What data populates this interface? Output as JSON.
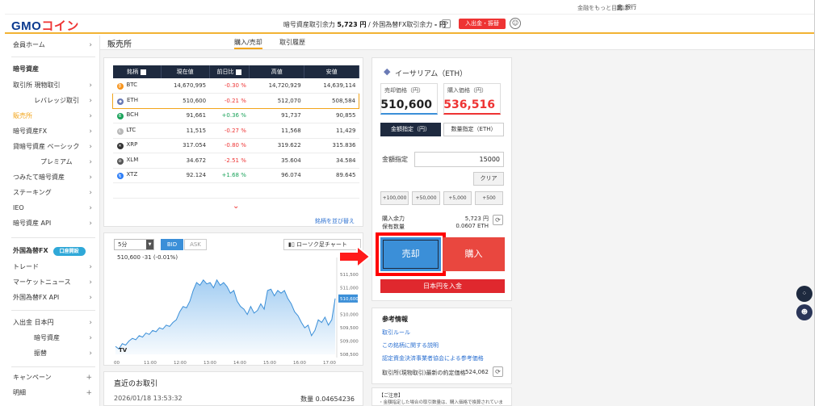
{
  "util_bar": {
    "text": "金融をもっと目的に",
    "bank": "銀行",
    "bank_icon": "bank-icon"
  },
  "header": {
    "logo_main": "GMO",
    "logo_sub": "コイン",
    "margin_label": "暗号資産取引余力",
    "margin_value": "5,723 円",
    "fx_label": "外国為替FX取引余力",
    "fx_value": "- 円",
    "deposit_label": "入出金・振替"
  },
  "sidebar": {
    "home": "会員ホーム",
    "crypto_head": "暗号資産",
    "spot": "取引所 現物取引",
    "leverage": "レバレッジ取引",
    "hanbaisho": "販売所",
    "crypto_fx": "暗号資産FX",
    "basket": "貸暗号資産 ベーシック",
    "premium": "プレミアム",
    "tsumitate": "つみたて暗号資産",
    "staking": "ステーキング",
    "ieo": "IEO",
    "api": "暗号資産 API",
    "fx_head": "外国為替FX",
    "fx_badge": "口座開設",
    "trade": "トレード",
    "market_news": "マーケットニュース",
    "fx_api": "外国為替FX API",
    "deposit_jpy": "入出金 日本円",
    "deposit_crypto": "暗号資産",
    "transfer": "振替",
    "campaign": "キャンペーン",
    "statement": "明細"
  },
  "page": {
    "title": "販売所",
    "tab_buy_sell": "購入/売却",
    "tab_history": "取引履歴"
  },
  "coin_table": {
    "headers": [
      "銘柄",
      "現在値",
      "前日比",
      "高値",
      "安値"
    ],
    "rows": [
      {
        "symbol": "BTC",
        "price": "14,670,995",
        "change": "-0.30 %",
        "high": "14,720,929",
        "low": "14,639,114",
        "dir": "neg",
        "color": "#f7931a",
        "glyph": "₿"
      },
      {
        "symbol": "ETH",
        "price": "510,600",
        "change": "-0.21 %",
        "high": "512,070",
        "low": "508,584",
        "dir": "neg",
        "color": "#6a7ab5",
        "glyph": "◆"
      },
      {
        "symbol": "BCH",
        "price": "91,661",
        "change": "+0.36 %",
        "high": "91,737",
        "low": "90,855",
        "dir": "pos",
        "color": "#1aa35a",
        "glyph": "B"
      },
      {
        "symbol": "LTC",
        "price": "11,515",
        "change": "-0.27 %",
        "high": "11,568",
        "low": "11,429",
        "dir": "neg",
        "color": "#b8b8b8",
        "glyph": "Ł"
      },
      {
        "symbol": "XRP",
        "price": "317.054",
        "change": "-0.80 %",
        "high": "319.622",
        "low": "315.836",
        "dir": "neg",
        "color": "#333333",
        "glyph": "✕"
      },
      {
        "symbol": "XLM",
        "price": "34.672",
        "change": "-2.51 %",
        "high": "35.604",
        "low": "34.584",
        "dir": "neg",
        "color": "#555555",
        "glyph": "⊘"
      },
      {
        "symbol": "XTZ",
        "price": "92.124",
        "change": "+1.68 %",
        "high": "96.074",
        "low": "89.645",
        "dir": "pos",
        "color": "#2c7df7",
        "glyph": "ꜩ"
      }
    ],
    "reorder": "銘柄を並び替え"
  },
  "chart_panel": {
    "interval": "5分",
    "bid": "BID",
    "ask": "ASK",
    "candle": "ローソク足チャート",
    "label": "510,600 -31 (-0.01%)",
    "logo": "TV"
  },
  "chart_data": {
    "type": "area",
    "x_ticks": [
      "00",
      "11:00",
      "12:00",
      "13:00",
      "14:00",
      "15:00",
      "16:00",
      "17:00"
    ],
    "y_ticks": [
      "511,500",
      "511,000",
      "510,600",
      "510,000",
      "509,500",
      "509,000",
      "508,500"
    ],
    "ylim": [
      508500,
      511900
    ],
    "current": 510600,
    "values": [
      508800,
      508700,
      508900,
      508850,
      509000,
      509100,
      509050,
      509200,
      509150,
      509300,
      509250,
      509400,
      509350,
      509500,
      509450,
      509600,
      509550,
      509700,
      509800,
      510100,
      510300,
      510250,
      510500,
      510900,
      511200,
      511100,
      511300,
      511150,
      511200,
      511000,
      511300,
      511100,
      511200,
      511050,
      510800,
      510900,
      510500,
      510300,
      510200,
      510000,
      510300,
      510050,
      510150,
      510400,
      510200,
      510900,
      510950,
      510700,
      510900,
      510800,
      510900,
      510600,
      510400,
      510100,
      509950,
      509700,
      509500,
      509600,
      509200,
      509400,
      509800,
      509700,
      509900,
      509600,
      509800,
      510600
    ]
  },
  "recent": {
    "title": "直近のお取引",
    "date": "2026/01/18 13:53:32",
    "qty": "数量 0.04654236"
  },
  "order": {
    "coin_title": "イーサリアム（ETH）",
    "sell_label": "売却価格（円）",
    "sell_price": "510,600",
    "buy_label": "購入価格（円）",
    "buy_price": "536,516",
    "mode_amount": "金額指定（円）",
    "mode_qty": "数量指定（ETH）",
    "amount_label": "金額指定",
    "amount_value": "15000",
    "clear": "クリア",
    "inc": [
      "+100,000",
      "+50,000",
      "+5,000",
      "+500"
    ],
    "margin_label": "購入余力",
    "margin_value": "5,723 円",
    "holding_label": "保有数量",
    "holding_value": "0.0607 ETH",
    "sell_btn": "売却",
    "buy_btn": "購入",
    "deposit_jpy": "日本円を入金"
  },
  "reference": {
    "title": "参考情報",
    "links": [
      "取引ルール",
      "この銘柄に関する説明",
      "認定資金決済事業者協会による参考価格"
    ],
    "last_price_label": "取引所(現物取引)最新の約定価格",
    "last_price_value": "524,062"
  },
  "note": {
    "title": "【ご注意】",
    "text": "・金額指定した場合の取引数量は、購入価格で換算されています。"
  },
  "colors": {
    "accent": "#f2a41a",
    "navy": "#1e2a3f",
    "sell": "#3b8fd8",
    "buy": "#e9473f",
    "highlight": "#ff0000"
  }
}
